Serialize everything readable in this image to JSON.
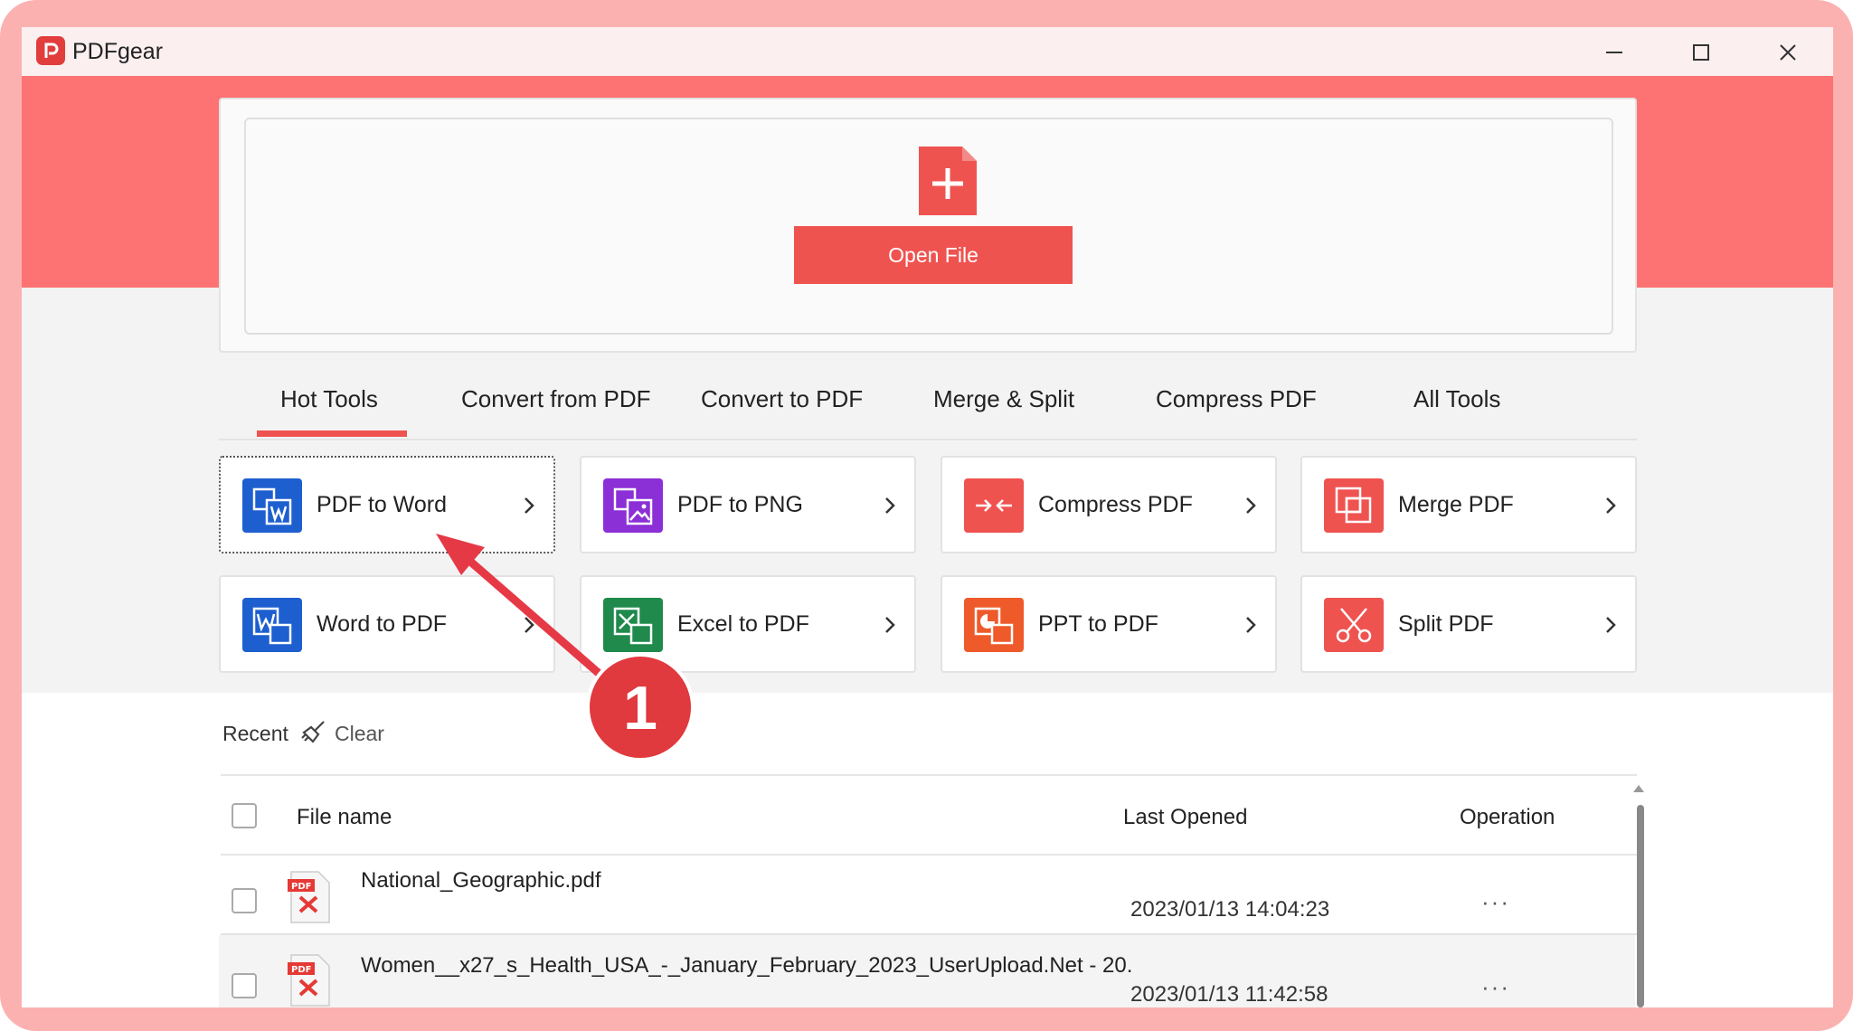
{
  "window": {
    "title": "PDFgear"
  },
  "drop_zone": {
    "open_button": "Open File"
  },
  "tabs": [
    {
      "label": "Hot Tools"
    },
    {
      "label": "Convert from PDF"
    },
    {
      "label": "Convert to PDF"
    },
    {
      "label": "Merge & Split"
    },
    {
      "label": "Compress PDF"
    },
    {
      "label": "All Tools"
    }
  ],
  "tools": [
    {
      "label": "PDF to Word",
      "icon": "pdf-to-word-icon",
      "color": "#1e5fcf"
    },
    {
      "label": "PDF to PNG",
      "icon": "pdf-to-png-icon",
      "color": "#8b2fd6"
    },
    {
      "label": "Compress PDF",
      "icon": "compress-icon",
      "color": "#ef5350"
    },
    {
      "label": "Merge PDF",
      "icon": "merge-icon",
      "color": "#ef5350"
    },
    {
      "label": "Word to PDF",
      "icon": "word-to-pdf-icon",
      "color": "#1e5fcf"
    },
    {
      "label": "Excel to PDF",
      "icon": "excel-to-pdf-icon",
      "color": "#1f8a4c"
    },
    {
      "label": "PPT to PDF",
      "icon": "ppt-to-pdf-icon",
      "color": "#ef5a2a"
    },
    {
      "label": "Split PDF",
      "icon": "split-icon",
      "color": "#ef5350"
    }
  ],
  "recent": {
    "label": "Recent",
    "clear": "Clear",
    "columns": {
      "file_name": "File name",
      "last_opened": "Last Opened",
      "operation": "Operation"
    },
    "files": [
      {
        "name": "National_Geographic.pdf",
        "date": "2023/01/13 14:04:23",
        "menu": "···"
      },
      {
        "name": "Women__x27_s_Health_USA_-_January_February_2023_UserUpload.Net - 20.",
        "date": "2023/01/13 11:42:58",
        "menu": "···"
      }
    ]
  },
  "annotation": {
    "step": "1"
  },
  "colors": {
    "accent": "#ef5350",
    "banner": "#fd7272",
    "frame": "#fcb1b1"
  }
}
